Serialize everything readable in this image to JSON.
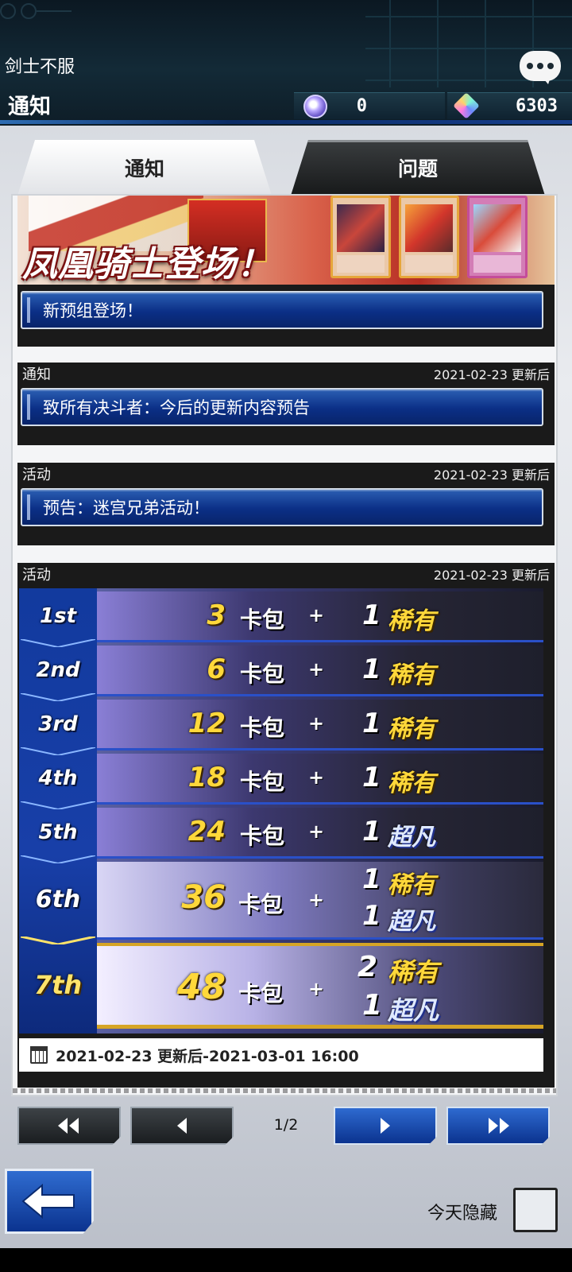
{
  "header": {
    "player_name": "剑士不服",
    "page_title": "通知",
    "orbs": "0",
    "gems": "6303"
  },
  "tabs": [
    {
      "label": "通知",
      "active": true
    },
    {
      "label": "问题",
      "active": false
    }
  ],
  "banner": {
    "title": "凤凰骑士登场！",
    "link_label": "新预组登场！"
  },
  "news": [
    {
      "category": "通知",
      "date": "2021-02-23 更新后",
      "title": "致所有决斗者：今后的更新内容预告"
    },
    {
      "category": "活动",
      "date": "2021-02-23 更新后",
      "title": "预告：迷宫兄弟活动！"
    },
    {
      "category": "活动",
      "date": "2021-02-23 更新后"
    }
  ],
  "rewards": {
    "packs_word": "卡包",
    "plus": "+",
    "rows": [
      {
        "rank": "1st",
        "packs": "3",
        "r1_count": "1",
        "r1_type": "稀有"
      },
      {
        "rank": "2nd",
        "packs": "6",
        "r1_count": "1",
        "r1_type": "稀有"
      },
      {
        "rank": "3rd",
        "packs": "12",
        "r1_count": "1",
        "r1_type": "稀有"
      },
      {
        "rank": "4th",
        "packs": "18",
        "r1_count": "1",
        "r1_type": "稀有"
      },
      {
        "rank": "5th",
        "packs": "24",
        "r1_count": "1",
        "r1_type": "超凡"
      },
      {
        "rank": "6th",
        "packs": "36",
        "r1_count": "1",
        "r1_type": "稀有",
        "r2_count": "1",
        "r2_type": "超凡"
      },
      {
        "rank": "7th",
        "packs": "48",
        "r1_count": "2",
        "r1_type": "稀有",
        "r2_count": "1",
        "r2_type": "超凡"
      }
    ],
    "period": "2021-02-23 更新后-2021-03-01 16:00"
  },
  "pagination": {
    "first": "⏪",
    "prev": "◀",
    "label": "1/2",
    "next": "▶",
    "last": "⏩"
  },
  "footer": {
    "hide_today_label": "今天隐藏",
    "hide_today_checked": false
  },
  "colors": {
    "accent_blue": "#0b2f86",
    "gold": "#ffd83a"
  }
}
